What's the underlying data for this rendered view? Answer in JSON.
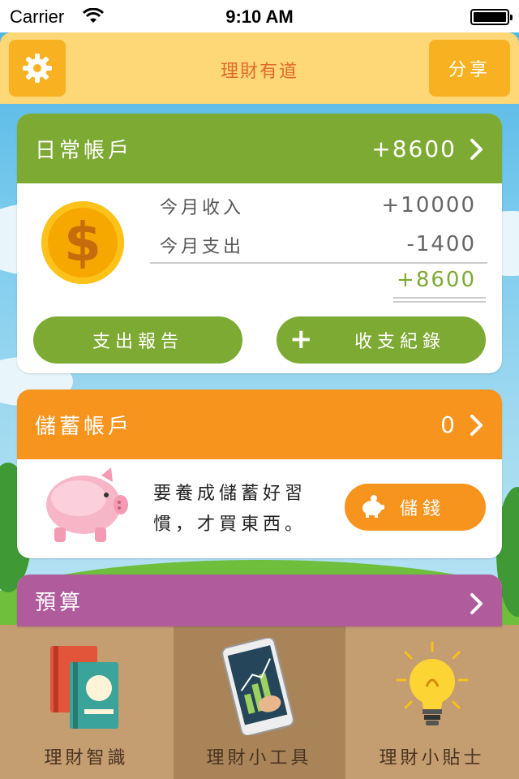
{
  "status_bar": {
    "carrier": "Carrier",
    "time": "9:10 AM"
  },
  "header": {
    "title": "理財有道",
    "share_label": "分享"
  },
  "daily_account": {
    "title": "日常帳戶",
    "balance": "+8600",
    "income_label": "今月收入",
    "income_value": "+10000",
    "expense_label": "今月支出",
    "expense_value": "-1400",
    "net_value": "+8600",
    "coin_symbol": "$",
    "report_button": "支出報告",
    "record_button_icon": "+",
    "record_button": "收支紀錄"
  },
  "savings_account": {
    "title": "儲蓄帳戶",
    "balance": "0",
    "message": "要養成儲蓄好習慣，才買東西。",
    "save_button": "儲錢"
  },
  "budget": {
    "title": "預算"
  },
  "bottom_tabs": [
    {
      "label": "理財智識",
      "icon": "books-icon"
    },
    {
      "label": "理財小工具",
      "icon": "phone-chart-icon"
    },
    {
      "label": "理財小貼士",
      "icon": "lightbulb-icon"
    }
  ],
  "colors": {
    "header_bg": "#fed776",
    "button_orange": "#f8b221",
    "title_text": "#e06a2b",
    "daily_green": "#7daa33",
    "savings_orange": "#f7941d",
    "budget_purple": "#af5b9c"
  }
}
